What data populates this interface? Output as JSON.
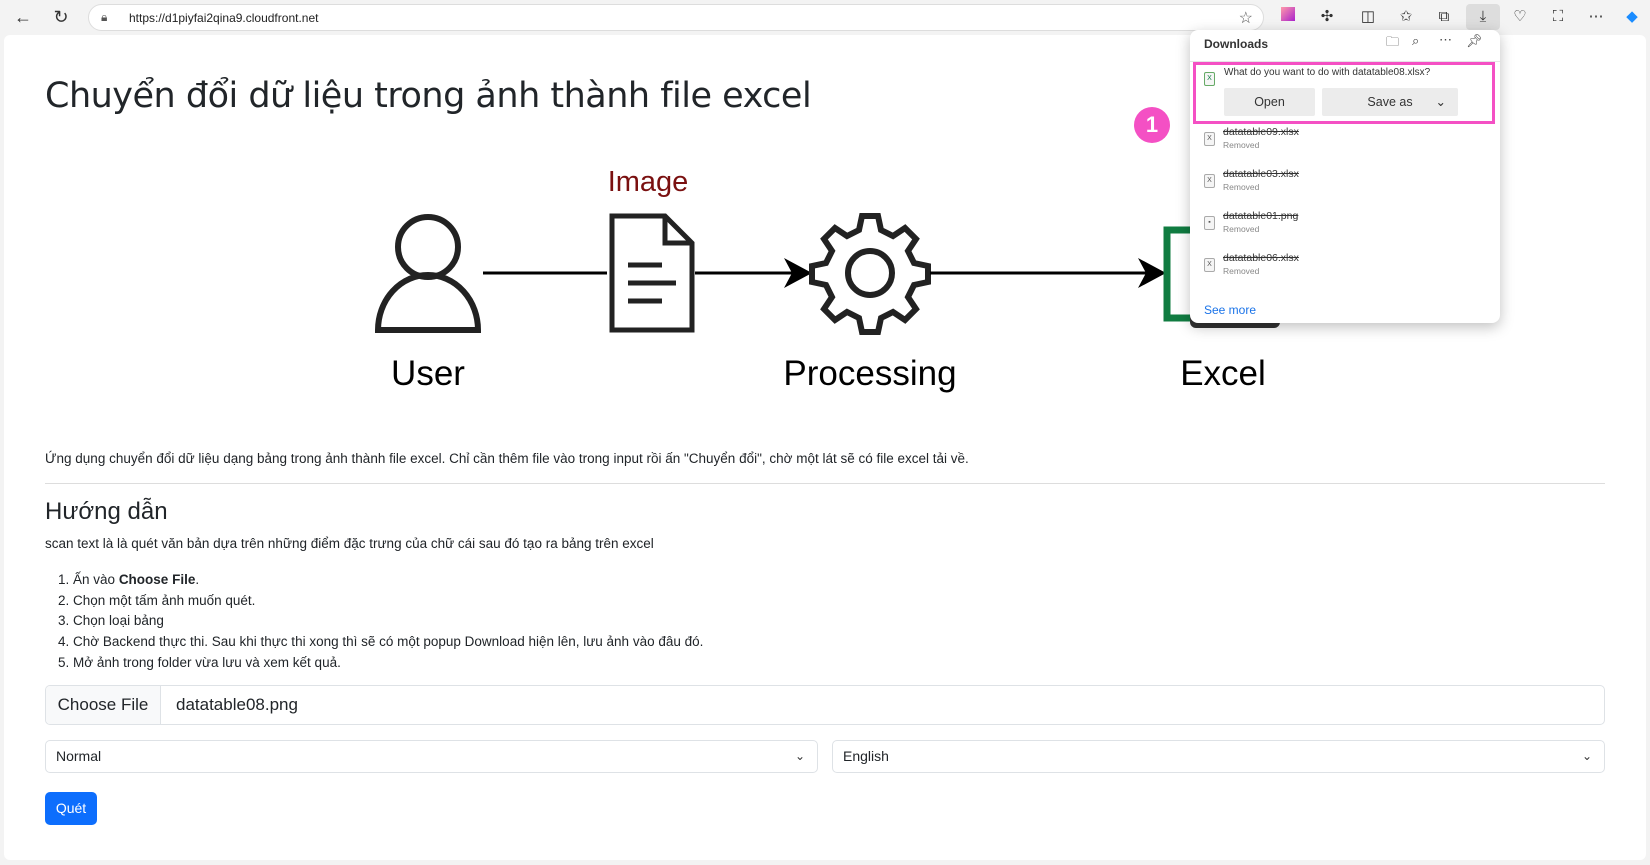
{
  "browser": {
    "url": "https://d1piyfai2qina9.cloudfront.net"
  },
  "page": {
    "title": "Chuyển đổi dữ liệu trong ảnh thành file excel",
    "diagram": {
      "image_label": "Image",
      "user_label": "User",
      "processing_label": "Processing",
      "excel_label": "Excel"
    },
    "description": "Ứng dụng chuyển đổi dữ liệu dạng bảng trong ảnh thành file excel. Chỉ cần thêm file vào trong input rồi ấn \"Chuyển đổi\", chờ một lát sẽ có file excel tải về.",
    "guide_heading": "Hướng dẫn",
    "guide_intro": "scan text là là quét văn bản dựa trên những điểm đặc trưng của chữ cái sau đó tạo ra bảng trên excel",
    "steps": [
      {
        "num": "1.",
        "pre": "Ấn vào ",
        "bold": "Choose File",
        "post": "."
      },
      {
        "num": "2.",
        "text": "Chọn một tấm ảnh muốn quét."
      },
      {
        "num": "3.",
        "text": "Chọn loại bảng"
      },
      {
        "num": "4.",
        "text": "Chờ Backend thực thi. Sau khi thực thi xong thì sẽ có một popup Download hiện lên, lưu ảnh vào đâu đó."
      },
      {
        "num": "5.",
        "text": "Mở ảnh trong folder vừa lưu và xem kết quả."
      }
    ],
    "file_input": {
      "button": "Choose File",
      "value": "datatable08.png"
    },
    "table_type_select": "Normal",
    "language_select": "English",
    "submit_label": "Quét"
  },
  "downloads": {
    "title": "Downloads",
    "prompt": "What do you want to do with datatable08.xlsx?",
    "open_label": "Open",
    "save_as_label": "Save as",
    "items": [
      {
        "name": "datatable09.xlsx",
        "status": "Removed"
      },
      {
        "name": "datatable03.xlsx",
        "status": "Removed"
      },
      {
        "name": "datatable01.png",
        "status": "Removed"
      },
      {
        "name": "datatable06.xlsx",
        "status": "Removed"
      }
    ],
    "see_more": "See more"
  },
  "annotation": {
    "badge": "1"
  },
  "colors": {
    "primary": "#0d6efd",
    "highlight": "#f450c4",
    "excel_green": "#107c41"
  }
}
